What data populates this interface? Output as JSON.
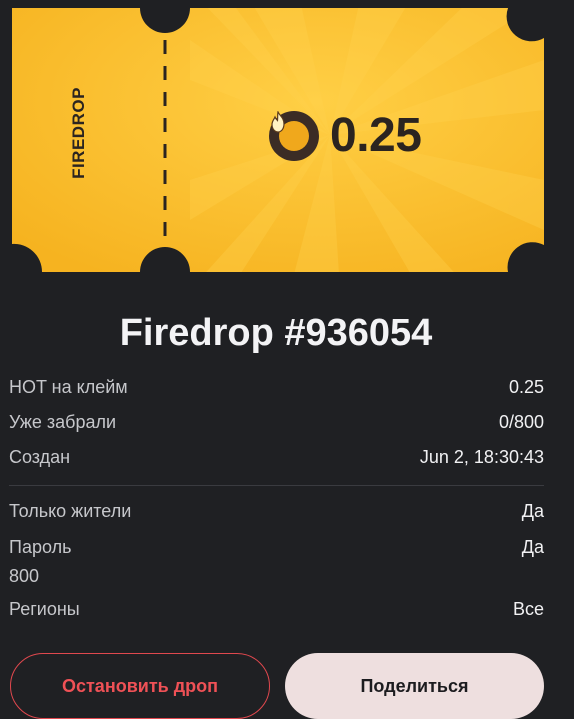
{
  "ticket": {
    "brand": "FIREDROP",
    "amount": "0.25",
    "coin_icon": "flame-coin-icon",
    "colors": {
      "ticket": "#f7b824",
      "ticket_light": "#ffc93a",
      "text": "#2b2420"
    }
  },
  "drop": {
    "title": "Firedrop #936054",
    "details": [
      {
        "label": "HOT на клейм",
        "value": "0.25"
      },
      {
        "label": "Уже забрали",
        "value": "0/800"
      },
      {
        "label": "Создан",
        "value": "Jun 2, 18:30:43"
      }
    ],
    "conditions": [
      {
        "label": "Только жители",
        "value": "Да"
      },
      {
        "label": "Пароль",
        "value": "Да",
        "extra": "800"
      },
      {
        "label": "Регионы",
        "value": "Все"
      }
    ]
  },
  "actions": {
    "stop_label": "Остановить дроп",
    "share_label": "Поделиться",
    "colors": {
      "stop": "#ef5156",
      "share_bg": "#eedfdf"
    }
  }
}
